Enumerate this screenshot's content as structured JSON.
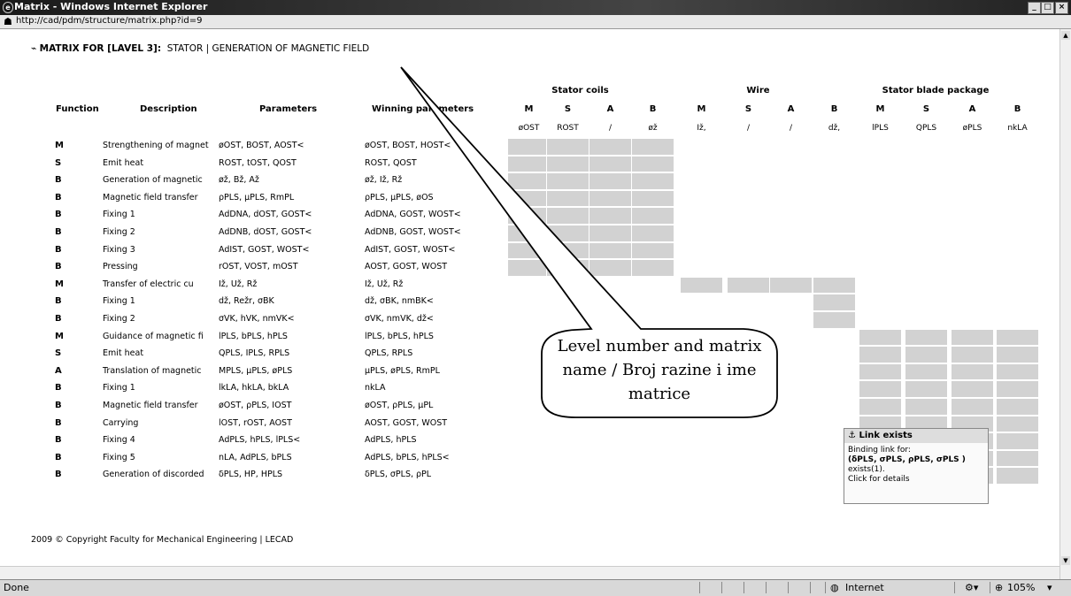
{
  "window": {
    "title": "Matrix - Windows Internet Explorer",
    "url": "http://cad/pdm/structure/matrix.php?id=9"
  },
  "page": {
    "title_prefix": "MATRIX FOR [LAVEL 3]:",
    "title_rest": "STATOR | GENERATION OF MAGNETIC FIELD",
    "headers": {
      "function": "Function",
      "description": "Description",
      "parameters": "Parameters",
      "winning": "Winning parameters"
    },
    "groups": [
      "Stator coils",
      "Wire",
      "Stator blade package"
    ],
    "sub": [
      "M",
      "S",
      "A",
      "B",
      "M",
      "S",
      "A",
      "B",
      "M",
      "S",
      "A",
      "B"
    ],
    "sub_params": [
      "øOST",
      "ROST",
      "/",
      "øž",
      "Iž,",
      "/",
      "/",
      "dž,",
      "lPLS",
      "QPLS",
      "øPLS",
      "nkLA"
    ],
    "rows": [
      {
        "t": "M",
        "d": "Strengthening of magnet",
        "p": "øOST, BOST, AOST<",
        "w": "øOST, BOST, HOST<"
      },
      {
        "t": "S",
        "d": "Emit heat",
        "p": "ROST, tOST, QOST",
        "w": "ROST, QOST"
      },
      {
        "t": "B",
        "d": "Generation of magnetic",
        "p": "øž, Bž, Až",
        "w": "øž, Iž, Rž"
      },
      {
        "t": "B",
        "d": "Magnetic field transfer",
        "p": "ρPLS, μPLS, RmPL",
        "w": "ρPLS, μPLS, øOS"
      },
      {
        "t": "B",
        "d": "Fixing 1",
        "p": "AdDNA, dOST, GOST<",
        "w": "AdDNA, GOST, WOST<"
      },
      {
        "t": "B",
        "d": "Fixing 2",
        "p": "AdDNB, dOST, GOST<",
        "w": "AdDNB, GOST, WOST<"
      },
      {
        "t": "B",
        "d": "Fixing 3",
        "p": "AdIST, GOST, WOST<",
        "w": "AdIST, GOST, WOST<"
      },
      {
        "t": "B",
        "d": "Pressing",
        "p": "rOST, VOST, mOST",
        "w": "AOST, GOST, WOST"
      },
      {
        "t": "M",
        "d": "Transfer of electric cu",
        "p": "Iž, Už, Rž",
        "w": "Iž, Už, Rž"
      },
      {
        "t": "B",
        "d": "Fixing 1",
        "p": "dž, Režr, σBK",
        "w": "dž, σBK, nmBK<"
      },
      {
        "t": "B",
        "d": "Fixing 2",
        "p": "σVK, hVK, nmVK<",
        "w": "σVK, nmVK, dž<"
      },
      {
        "t": "M",
        "d": "Guidance of magnetic fi",
        "p": "lPLS, bPLS, hPLS",
        "w": "lPLS, bPLS, hPLS"
      },
      {
        "t": "S",
        "d": "Emit heat",
        "p": "QPLS, IPLS, RPLS",
        "w": "QPLS, RPLS"
      },
      {
        "t": "A",
        "d": "Translation of magnetic",
        "p": "MPLS, μPLS, øPLS",
        "w": "μPLS, øPLS, RmPL"
      },
      {
        "t": "B",
        "d": "Fixing 1",
        "p": "lkLA, hkLA, bkLA",
        "w": "nkLA"
      },
      {
        "t": "B",
        "d": "Magnetic field transfer",
        "p": "øOST, ρPLS, IOST",
        "w": "øOST, ρPLS, μPL"
      },
      {
        "t": "B",
        "d": "Carrying",
        "p": "lOST, rOST, AOST",
        "w": "AOST, GOST, WOST"
      },
      {
        "t": "B",
        "d": "Fixing 4",
        "p": "AdPLS, hPLS, lPLS<",
        "w": "AdPLS, hPLS"
      },
      {
        "t": "B",
        "d": "Fixing 5",
        "p": "nLA, AdPLS, bPLS",
        "w": "AdPLS, bPLS, hPLS<"
      },
      {
        "t": "B",
        "d": "Generation of discorded",
        "p": "δPLS, HP, HPLS",
        "w": "δPLS, σPLS, ρPL"
      }
    ],
    "footer": "2009 © Copyright Faculty for Mechanical Engineering | LECAD"
  },
  "callout": "Level number and matrix name / Broj razine i ime matrice",
  "tooltip": {
    "title": "Link exists",
    "l1": "Binding link for:",
    "l2": "(δPLS, σPLS, ρPLS, σPLS )",
    "l3": "exists(1).",
    "l4": "Click for details"
  },
  "status": {
    "left": "Done",
    "zone": "Internet",
    "zoom": "105%"
  }
}
